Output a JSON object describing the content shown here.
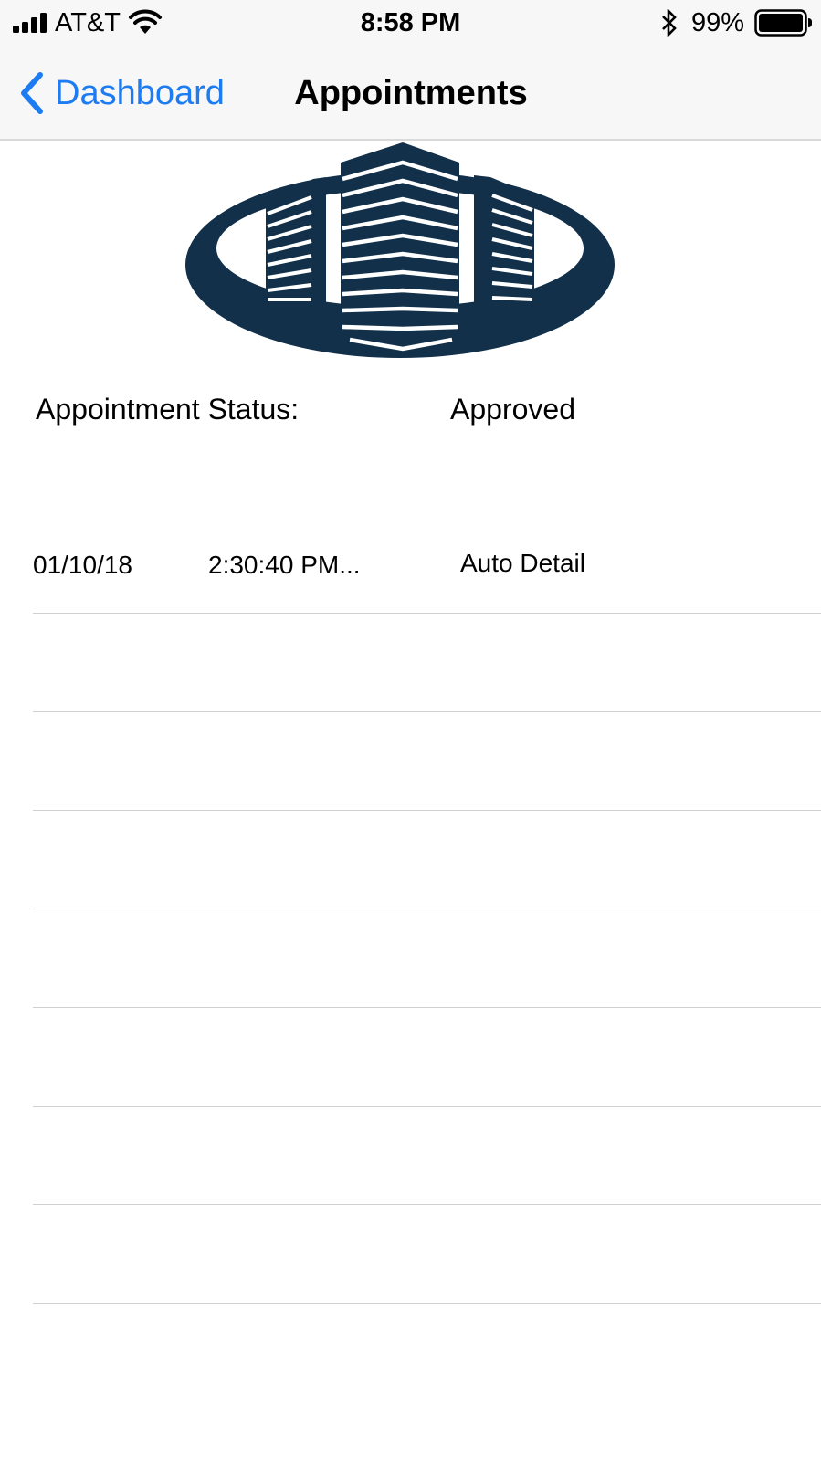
{
  "status_bar": {
    "carrier": "AT&T",
    "time": "8:58 PM",
    "battery_percent": "99%",
    "icons": [
      "signal-icon",
      "wifi-icon",
      "bluetooth-icon",
      "battery-icon"
    ]
  },
  "nav": {
    "back_label": "Dashboard",
    "title": "Appointments"
  },
  "logo": {
    "icon": "building-logo",
    "color": "#12304a"
  },
  "appointment": {
    "status_label": "Appointment Status:",
    "status_value": "Approved"
  },
  "table": {
    "rows": [
      {
        "date": "01/10/18",
        "time": "2:30:40 PM...",
        "service": "Auto Detail"
      },
      {
        "date": "",
        "time": "",
        "service": ""
      },
      {
        "date": "",
        "time": "",
        "service": ""
      },
      {
        "date": "",
        "time": "",
        "service": ""
      },
      {
        "date": "",
        "time": "",
        "service": ""
      },
      {
        "date": "",
        "time": "",
        "service": ""
      },
      {
        "date": "",
        "time": "",
        "service": ""
      },
      {
        "date": "",
        "time": "",
        "service": ""
      }
    ]
  },
  "colors": {
    "accent": "#1d7cf2",
    "bar_background": "#f7f7f7",
    "separator": "#d0d0d0"
  }
}
